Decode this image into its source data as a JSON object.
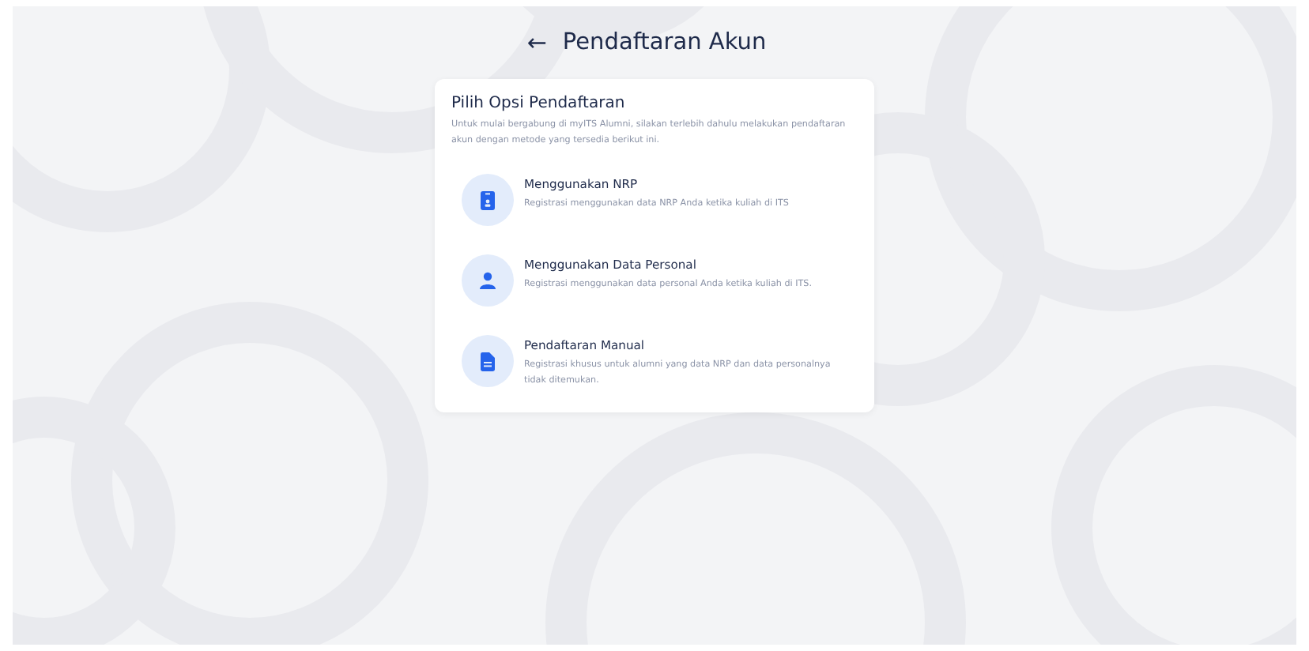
{
  "header": {
    "back_icon": "←",
    "title": "Pendaftaran Akun"
  },
  "card": {
    "title": "Pilih Opsi Pendaftaran",
    "description": "Untuk mulai bergabung di myITS Alumni, silakan terlebih dahulu melakukan pendaftaran akun dengan metode yang tersedia berikut ini.",
    "options": [
      {
        "kind": "id-card",
        "title": "Menggunakan NRP",
        "description": "Registrasi menggunakan data NRP Anda ketika kuliah di ITS"
      },
      {
        "kind": "person",
        "title": "Menggunakan Data Personal",
        "description": "Registrasi menggunakan data personal Anda ketika kuliah di ITS."
      },
      {
        "kind": "document",
        "title": "Pendaftaran Manual",
        "description": "Registrasi khusus untuk alumni yang data NRP dan data personalnya tidak ditemukan."
      }
    ]
  }
}
